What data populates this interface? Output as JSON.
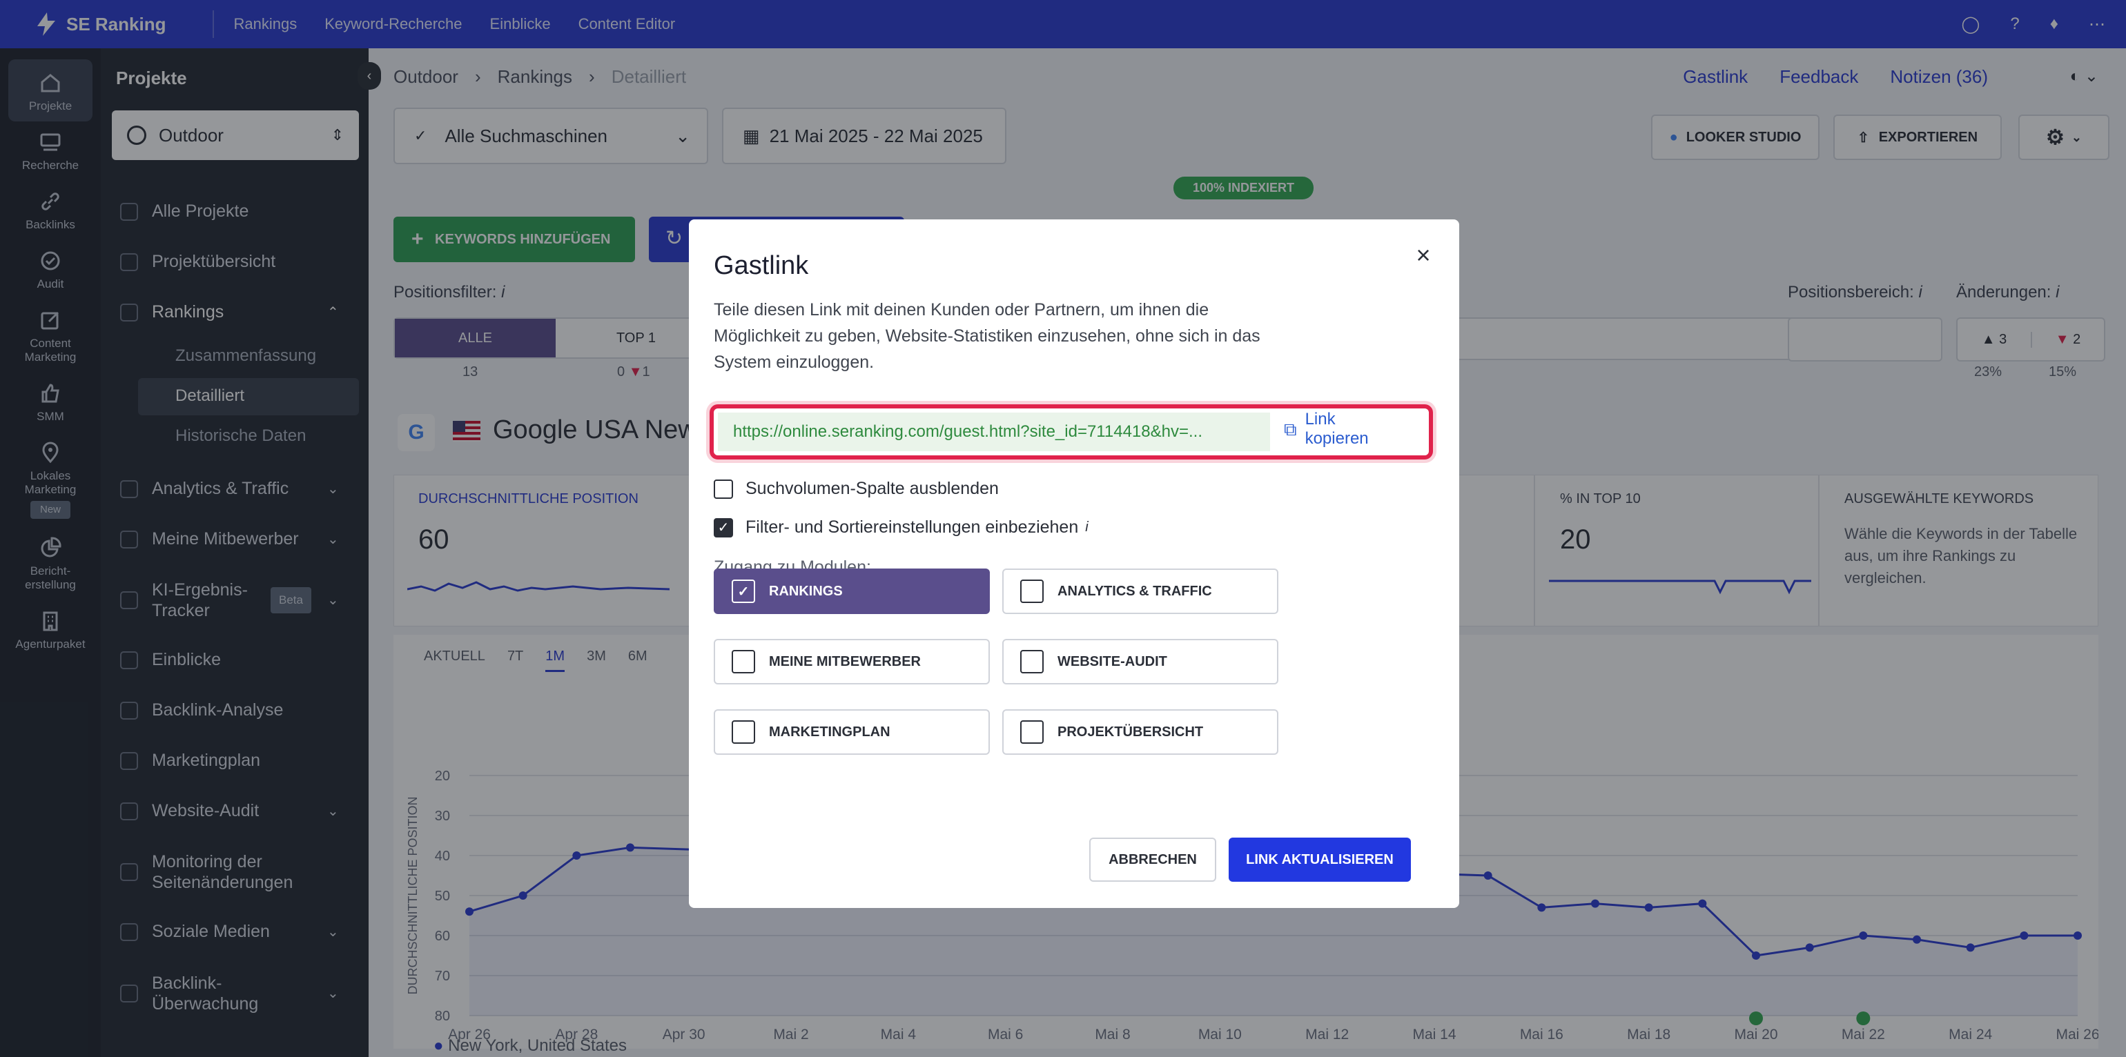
{
  "app": {
    "name": "SE Ranking"
  },
  "topnav": [
    "Rankings",
    "Keyword-Recherche",
    "Einblicke",
    "Content Editor"
  ],
  "iconbar": [
    {
      "label": "Projekte",
      "icon": "home-icon"
    },
    {
      "label": "Recherche",
      "icon": "research-icon"
    },
    {
      "label": "Backlinks",
      "icon": "link-icon"
    },
    {
      "label": "Audit",
      "icon": "audit-icon"
    },
    {
      "label": "Content Marketing",
      "icon": "edit-icon"
    },
    {
      "label": "SMM",
      "icon": "thumb-icon"
    },
    {
      "label": "Lokales Marketing",
      "icon": "pin-icon",
      "badge": "New"
    },
    {
      "label": "Bericht-erstellung",
      "icon": "report-icon"
    },
    {
      "label": "Agenturpaket",
      "icon": "building-icon"
    }
  ],
  "sidebar": {
    "title": "Projekte",
    "project": "Outdoor",
    "items": [
      "Alle Projekte",
      "Projektübersicht",
      "Rankings",
      "Analytics & Traffic",
      "Meine Mitbewerber",
      "KI-Ergebnis-Tracker",
      "Einblicke",
      "Backlink-Analyse",
      "Marketingplan",
      "Website-Audit",
      "Monitoring der Seitenänderungen",
      "Soziale Medien",
      "Backlink-Überwachung"
    ],
    "ai_badge": "Beta",
    "rankings_sub": [
      "Zusammenfassung",
      "Detailliert",
      "Historische Daten"
    ]
  },
  "breadcrumb": [
    "Outdoor",
    "Rankings",
    "Detailliert"
  ],
  "header_links": {
    "guest": "Gastlink",
    "feedback": "Feedback",
    "notes": "Notizen (36)"
  },
  "toolbar": {
    "engines": "Alle Suchmaschinen",
    "date": "21 Mai 2025 - 22 Mai 2025",
    "looker": "LOOKER STUDIO",
    "export": "EXPORTIEREN",
    "indexed": "100% INDEXIERT",
    "add_keywords": "KEYWORDS HINZUFÜGEN"
  },
  "filters": {
    "position_filter": "Positionsfilter:",
    "all": "ALLE",
    "top1": "TOP 1",
    "all_count": "13",
    "top1_count": "0",
    "top1_down": "1",
    "range_label": "Positionsbereich:",
    "changes_label": "Änderungen:",
    "up": "3",
    "down": "2",
    "up_pct": "23%",
    "down_pct": "15%"
  },
  "engine_title": "Google USA New",
  "kpis": {
    "avg_label": "DURCHSCHNITTLICHE POSITION",
    "avg_value": "60",
    "top10_label": "% IN TOP 10",
    "top10_value": "20",
    "selected_label": "AUSGEWÄHLTE KEYWORDS",
    "selected_text": "Wähle die Keywords in der Tabelle aus, um ihre Rankings zu vergleichen."
  },
  "periods": [
    "AKTUELL",
    "7T",
    "1M",
    "3M",
    "6M"
  ],
  "chart_data": {
    "type": "line",
    "ylabel": "DURCHSCHNITTLICHE POSITION",
    "ylim": [
      20,
      80
    ],
    "y_inverted": true,
    "y_ticks": [
      20,
      30,
      40,
      50,
      60,
      70,
      80
    ],
    "x_ticks": [
      "Apr 26",
      "Apr 28",
      "Apr 30",
      "Mai 2",
      "Mai 4",
      "Mai 6",
      "Mai 8",
      "Mai 10",
      "Mai 12",
      "Mai 14",
      "Mai 16",
      "Mai 18",
      "Mai 20",
      "Mai 22",
      "Mai 24",
      "Mai 26"
    ],
    "x": [
      "Apr 26",
      "Apr 27",
      "Apr 28",
      "Apr 29",
      "Mai 15",
      "Mai 16",
      "Mai 17",
      "Mai 18",
      "Mai 19",
      "Mai 20",
      "Mai 21",
      "Mai 22",
      "Mai 23",
      "Mai 24",
      "Mai 25",
      "Mai 26"
    ],
    "series": [
      {
        "values": [
          54,
          50,
          40,
          38,
          45,
          53,
          52,
          53,
          52,
          65,
          63,
          60,
          61,
          63,
          60,
          60
        ]
      }
    ],
    "legend": "New York, United States"
  },
  "modal": {
    "title": "Gastlink",
    "description": "Teile diesen Link mit deinen Kunden oder Partnern, um ihnen die Möglichkeit zu geben, Website-Statistiken einzusehen, ohne sich in das System einzuloggen.",
    "url": "https://online.seranking.com/guest.html?site_id=7114418&hv=...",
    "copy_label": "Link kopieren",
    "hide_volume": "Suchvolumen-Spalte ausblenden",
    "include_filters": "Filter- und Sortiereinstellungen einbeziehen",
    "modules_label": "Zugang zu Modulen:",
    "modules": [
      {
        "label": "RANKINGS",
        "checked": true
      },
      {
        "label": "ANALYTICS & TRAFFIC",
        "checked": false
      },
      {
        "label": "MEINE MITBEWERBER",
        "checked": false
      },
      {
        "label": "WEBSITE-AUDIT",
        "checked": false
      },
      {
        "label": "MARKETINGPLAN",
        "checked": false
      },
      {
        "label": "PROJEKTÜBERSICHT",
        "checked": false
      }
    ],
    "cancel": "ABBRECHEN",
    "update": "LINK AKTUALISIEREN"
  }
}
